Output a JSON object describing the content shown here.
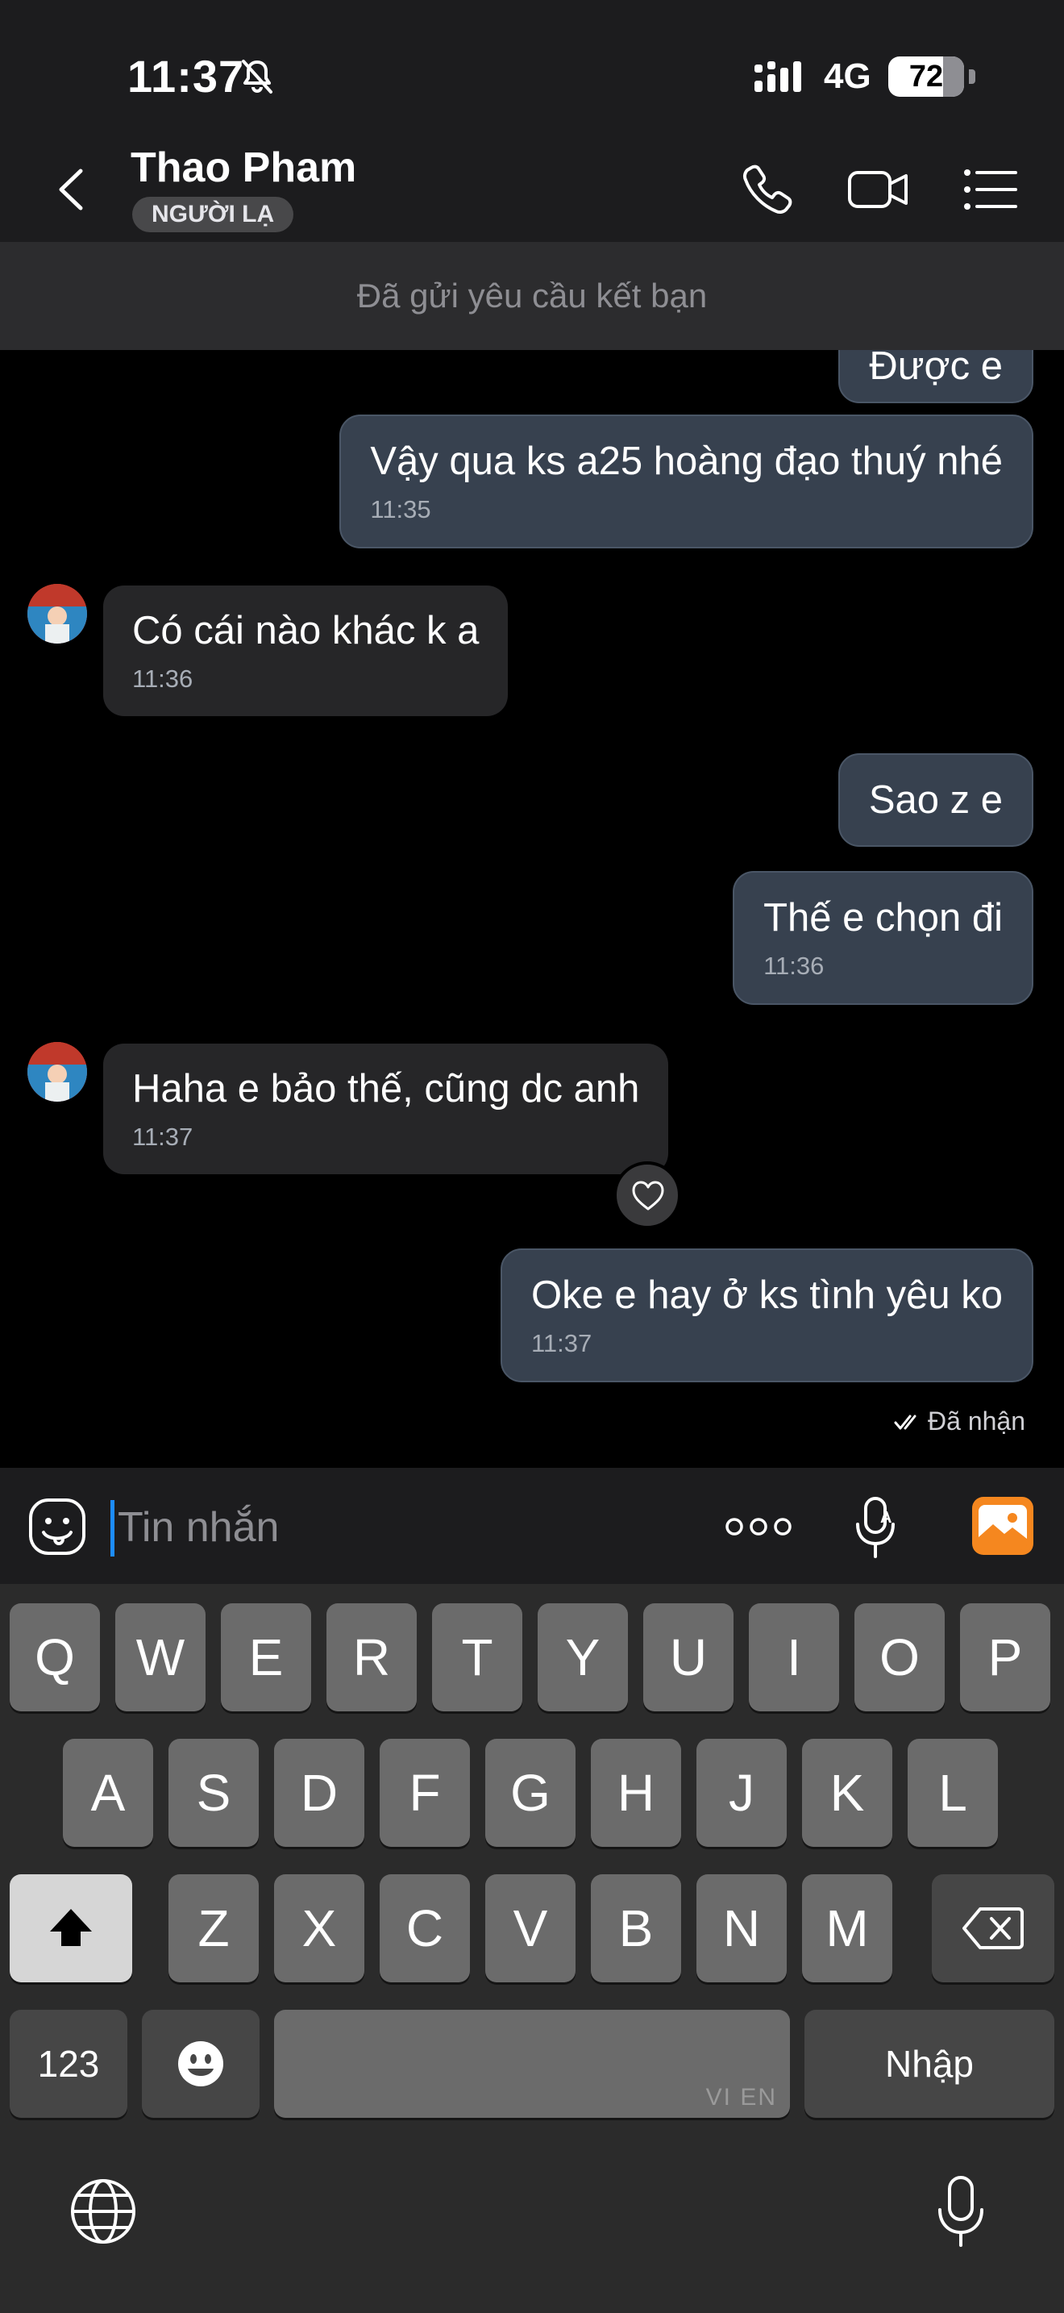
{
  "status_bar": {
    "time": "11:37",
    "network": "4G",
    "battery": "72"
  },
  "header": {
    "name": "Thao Pham",
    "badge": "NGƯỜI LẠ"
  },
  "banner": {
    "text": "Đã gửi yêu cầu kết bạn"
  },
  "messages": [
    {
      "direction": "out",
      "text": "Được e",
      "time": ""
    },
    {
      "direction": "out",
      "text": "Vậy qua ks a25 hoàng đạo thuý nhé",
      "time": "11:35"
    },
    {
      "direction": "in",
      "text": "Có cái nào khác k a",
      "time": "11:36"
    },
    {
      "direction": "out",
      "text": "Sao z e",
      "time": ""
    },
    {
      "direction": "out",
      "text": "Thế e chọn đi",
      "time": "11:36"
    },
    {
      "direction": "in",
      "text": "Haha e bảo thế, cũng dc anh",
      "time": "11:37"
    },
    {
      "direction": "out",
      "text": "Oke e hay ở ks tình yêu ko",
      "time": "11:37"
    }
  ],
  "receipt": "Đã nhận",
  "composer": {
    "placeholder": "Tin nhắn"
  },
  "keyboard": {
    "row1": [
      "Q",
      "W",
      "E",
      "R",
      "T",
      "Y",
      "U",
      "I",
      "O",
      "P"
    ],
    "row2": [
      "A",
      "S",
      "D",
      "F",
      "G",
      "H",
      "J",
      "K",
      "L"
    ],
    "row3": [
      "Z",
      "X",
      "C",
      "V",
      "B",
      "N",
      "M"
    ],
    "numbers_key": "123",
    "return_key": "Nhập",
    "space_brand": "VI EN"
  },
  "colors": {
    "outgoing_bubble": "#37414f",
    "incoming_bubble": "#262628",
    "accent": "#1d8cff",
    "image_button": "#f5871f"
  }
}
